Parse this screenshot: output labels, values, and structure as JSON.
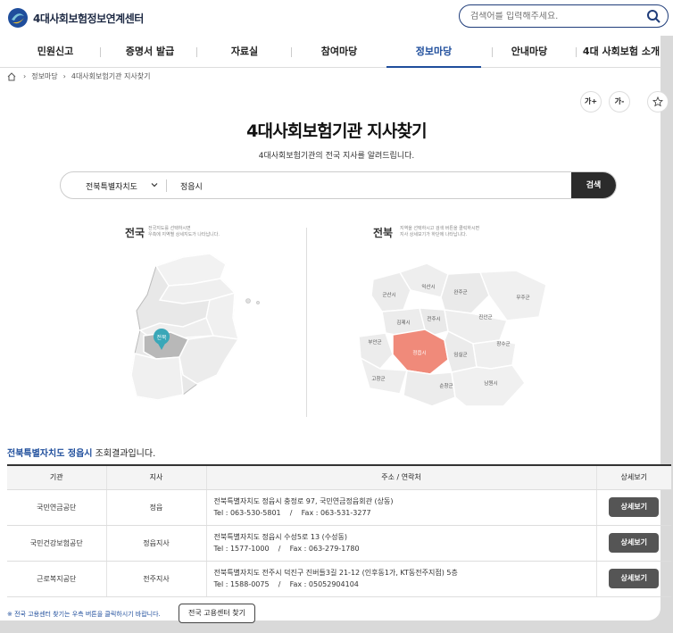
{
  "header": {
    "logo_text": "4대사회보험정보연계센터",
    "search_placeholder": "검색어를 입력해주세요."
  },
  "nav": {
    "items": [
      "민원신고",
      "증명서 발급",
      "자료실",
      "참여마당",
      "정보마당",
      "안내마당",
      "4대 사회보험 소개"
    ],
    "active": "정보마당"
  },
  "breadcrumb": [
    "정보마당",
    "4대사회보험기관 지사찾기"
  ],
  "tools": {
    "font_up": "가+",
    "font_down": "가-"
  },
  "page": {
    "title": "4대사회보험기관 지사찾기",
    "subtitle": "4대사회보험기관의 전국 지사를 알려드립니다."
  },
  "search": {
    "region": "전북특별자치도",
    "city": "정읍시",
    "button": "검색"
  },
  "map_national": {
    "label": "전국",
    "desc": [
      "전국지도를 선택하시면",
      "우측에 지역별 상세지도가 나타납니다."
    ],
    "marker": "전북"
  },
  "map_region": {
    "label": "전북",
    "desc": [
      "지역을 선택하시고 검색 버튼을 클릭하시면",
      "지사 상세보기가 하단에 나타납니다."
    ],
    "cities": [
      "군산시",
      "익산시",
      "완주군",
      "무주군",
      "김제시",
      "전주시",
      "진안군",
      "부안군",
      "정읍시",
      "임실군",
      "장수군",
      "고창군",
      "순창군",
      "남원시"
    ],
    "selected": "정읍시"
  },
  "results": {
    "query": "전북특별자치도 정읍시",
    "suffix": "조회결과입니다.",
    "columns": [
      "기관",
      "지사",
      "주소 / 연락처",
      "상세보기"
    ],
    "rows": [
      {
        "org": "국민연금공단",
        "branch": "정읍",
        "addr": "전북특별자치도 정읍시 충정로 97, 국민연금정읍회관 (상동)",
        "tel": "Tel : 063-530-5801",
        "fax": "Fax : 063-531-3277",
        "btn": "상세보기"
      },
      {
        "org": "국민건강보험공단",
        "branch": "정읍지사",
        "addr": "전북특별자치도 정읍시 수성5로 13 (수성동)",
        "tel": "Tel : 1577-1000",
        "fax": "Fax : 063-279-1780",
        "btn": "상세보기"
      },
      {
        "org": "근로복지공단",
        "branch": "전주지사",
        "addr": "전북특별자치도 전주시 덕진구 진버들3길 21-12 (인후동1가, KT동전주지점) 5층",
        "tel": "Tel : 1588-0075",
        "fax": "Fax : 05052904104",
        "btn": "상세보기"
      }
    ],
    "sep": "/"
  },
  "footer": {
    "note": "※ 전국 고용센터 찾기는 우측 버튼을 클릭하시기 바랍니다.",
    "button": "전국 고용센터 찾기"
  },
  "colors": {
    "accent": "#1f4e9c",
    "selected_region": "#f08a7a",
    "marker": "#3aa7b8"
  }
}
